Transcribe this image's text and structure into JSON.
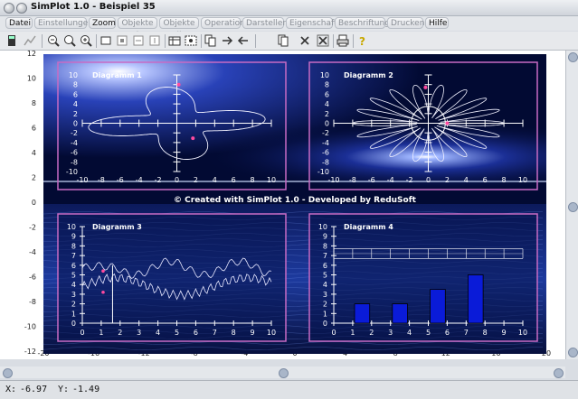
{
  "window": {
    "title": "SimPlot 1.0 - Beispiel 35"
  },
  "menu": [
    {
      "label": "Datei",
      "active": true
    },
    {
      "label": "Einstellungen",
      "active": false
    },
    {
      "label": "Zoom",
      "active": true
    },
    {
      "label": "Objekte I",
      "active": false
    },
    {
      "label": "Objekte II",
      "active": false
    },
    {
      "label": "Operation",
      "active": false
    },
    {
      "label": "Darstellen",
      "active": false
    },
    {
      "label": "Eigenschaft",
      "active": false
    },
    {
      "label": "Beschriftung",
      "active": false
    },
    {
      "label": "Drucken",
      "active": false
    },
    {
      "label": "Hilfe",
      "active": true
    }
  ],
  "toolbar_icons": [
    "calculator-icon",
    "line-chart-icon",
    "zoom-out-icon",
    "zoom-icon",
    "zoom-in-icon",
    "rectangle-icon",
    "fit-page-icon",
    "fit-width-icon",
    "table-icon",
    "screenshot-icon",
    "copy-icon",
    "arrow-right-icon",
    "arrow-left-icon",
    "duplicate-icon",
    "delete-icon",
    "delete-all-icon",
    "print-icon",
    "help-icon"
  ],
  "main_axes": {
    "x_ticks": [
      "-20",
      "-16",
      "-12",
      "-8",
      "-4",
      "0",
      "4",
      "8",
      "12",
      "16",
      "20"
    ],
    "y_ticks": [
      "12",
      "10",
      "8",
      "6",
      "4",
      "2",
      "0",
      "-2",
      "-4",
      "-6",
      "-8",
      "-10",
      "-12"
    ]
  },
  "credit": "© Created with SimPlot 1.0 - Developed by ReduSoft",
  "diagrams": [
    {
      "title": "Diagramm 1",
      "x_ticks": [
        "-10",
        "-8",
        "-6",
        "-4",
        "-2",
        "0",
        "2",
        "4",
        "6",
        "8",
        "10"
      ],
      "y_ticks": [
        "10",
        "8",
        "6",
        "4",
        "2",
        "0",
        "-2",
        "-4",
        "-6",
        "-8",
        "-10"
      ]
    },
    {
      "title": "Diagramm 2",
      "x_ticks": [
        "-10",
        "-8",
        "-6",
        "-4",
        "-2",
        "0",
        "2",
        "4",
        "6",
        "8",
        "10"
      ],
      "y_ticks": [
        "10",
        "8",
        "6",
        "4",
        "2",
        "0",
        "-2",
        "-4",
        "-6",
        "-8",
        "-10"
      ]
    },
    {
      "title": "Diagramm 3",
      "x_ticks": [
        "0",
        "1",
        "2",
        "3",
        "4",
        "5",
        "6",
        "7",
        "8",
        "9",
        "10"
      ],
      "y_ticks": [
        "10",
        "9",
        "8",
        "7",
        "6",
        "5",
        "4",
        "3",
        "2",
        "1",
        "0"
      ]
    },
    {
      "title": "Diagramm 4",
      "x_ticks": [
        "0",
        "1",
        "2",
        "3",
        "4",
        "5",
        "6",
        "7",
        "8",
        "9",
        "10"
      ],
      "y_ticks": [
        "10",
        "9",
        "8",
        "7",
        "6",
        "5",
        "4",
        "3",
        "2",
        "1",
        "0"
      ]
    }
  ],
  "diagram4_bars": [
    {
      "x": 1.5,
      "value": 2
    },
    {
      "x": 3.5,
      "value": 2
    },
    {
      "x": 5.5,
      "value": 3.5
    },
    {
      "x": 7.5,
      "value": 5
    }
  ],
  "status": {
    "x_label": "X:",
    "x_value": "-6.97",
    "y_label": "Y:",
    "y_value": "-1.49"
  },
  "colors": {
    "frame": "#c86bc4",
    "bar": "#0a1bd8",
    "bg_dark": "#020a33"
  }
}
